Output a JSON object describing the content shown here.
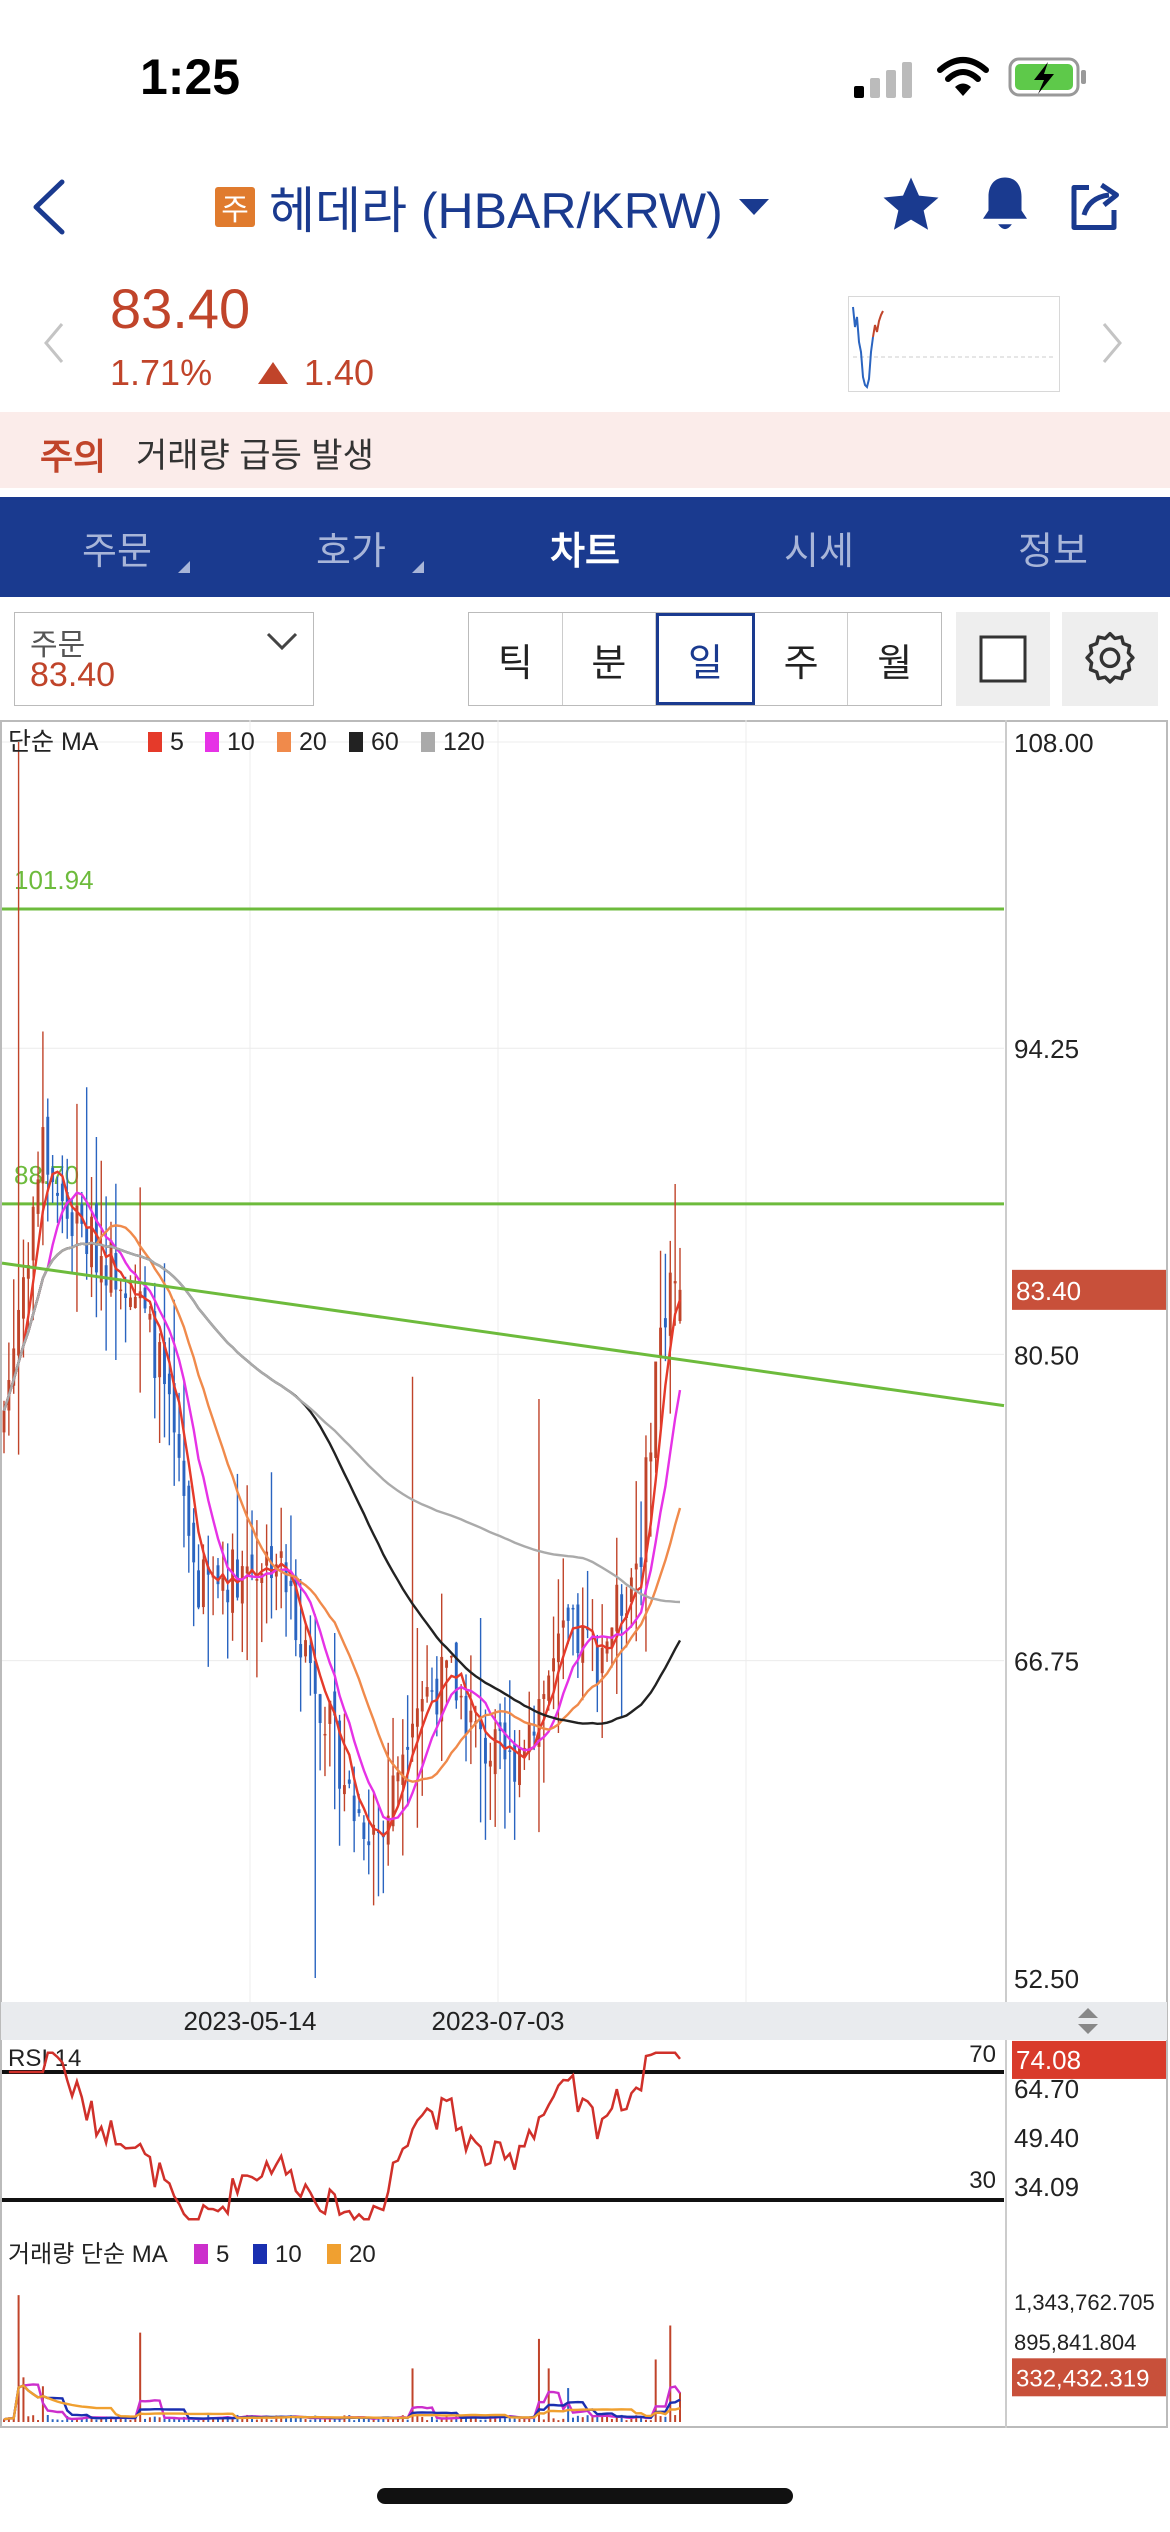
{
  "status": {
    "time": "1:25"
  },
  "header": {
    "badge": "주",
    "title": "헤데라 (HBAR/KRW)",
    "icons": [
      "back-icon",
      "star-icon",
      "bell-icon",
      "share-icon"
    ]
  },
  "price": {
    "current": "83.40",
    "change_pct": "1.71%",
    "change_abs": "1.40",
    "color": "#c0442a"
  },
  "notice": {
    "tag": "주의",
    "text": "거래량 급등 발생"
  },
  "tabs": [
    {
      "label": "주문"
    },
    {
      "label": "호가"
    },
    {
      "label": "차트"
    },
    {
      "label": "시세"
    },
    {
      "label": "정보"
    }
  ],
  "active_tab": "차트",
  "controls": {
    "order_label": "주문",
    "order_value": "83.40",
    "intervals": [
      "틱",
      "분",
      "일",
      "주",
      "월"
    ],
    "active_interval": "일"
  },
  "chart_data": {
    "type": "candlestick",
    "main": {
      "legend_prefix": "단순 MA",
      "ma": [
        {
          "name": "5",
          "color": "#e53a2a"
        },
        {
          "name": "10",
          "color": "#e632e6"
        },
        {
          "name": "20",
          "color": "#f08a4b"
        },
        {
          "name": "60",
          "color": "#222222"
        },
        {
          "name": "120",
          "color": "#aaaaaa"
        }
      ],
      "y_ticks": [
        "108.00",
        "94.25",
        "80.50",
        "66.75",
        "52.50"
      ],
      "ylim": [
        52.5,
        108
      ],
      "price_tag": "83.40",
      "hlines": [
        {
          "label": "101.94",
          "value": 101.94
        },
        {
          "label": "88.70",
          "value": 88.7
        }
      ],
      "x_ticks": [
        "2023-05-14",
        "2023-07-03"
      ],
      "colors": {
        "up": "#c0442a",
        "down": "#2a64c0",
        "trend": "#6dbb3c"
      }
    },
    "rsi": {
      "label": "RSI 14",
      "levels": [
        "70",
        "30"
      ],
      "y_ticks": [
        "64.70",
        "49.40",
        "34.09"
      ],
      "current": "74.08"
    },
    "volume": {
      "legend_prefix": "거래량 단순 MA",
      "ma": [
        {
          "name": "5",
          "color": "#cc2fcc"
        },
        {
          "name": "10",
          "color": "#1a2fb0"
        },
        {
          "name": "20",
          "color": "#f0a030"
        }
      ],
      "y_ticks": [
        "1,343,762.705",
        "895,841.804"
      ],
      "current": "332,432.319"
    }
  }
}
